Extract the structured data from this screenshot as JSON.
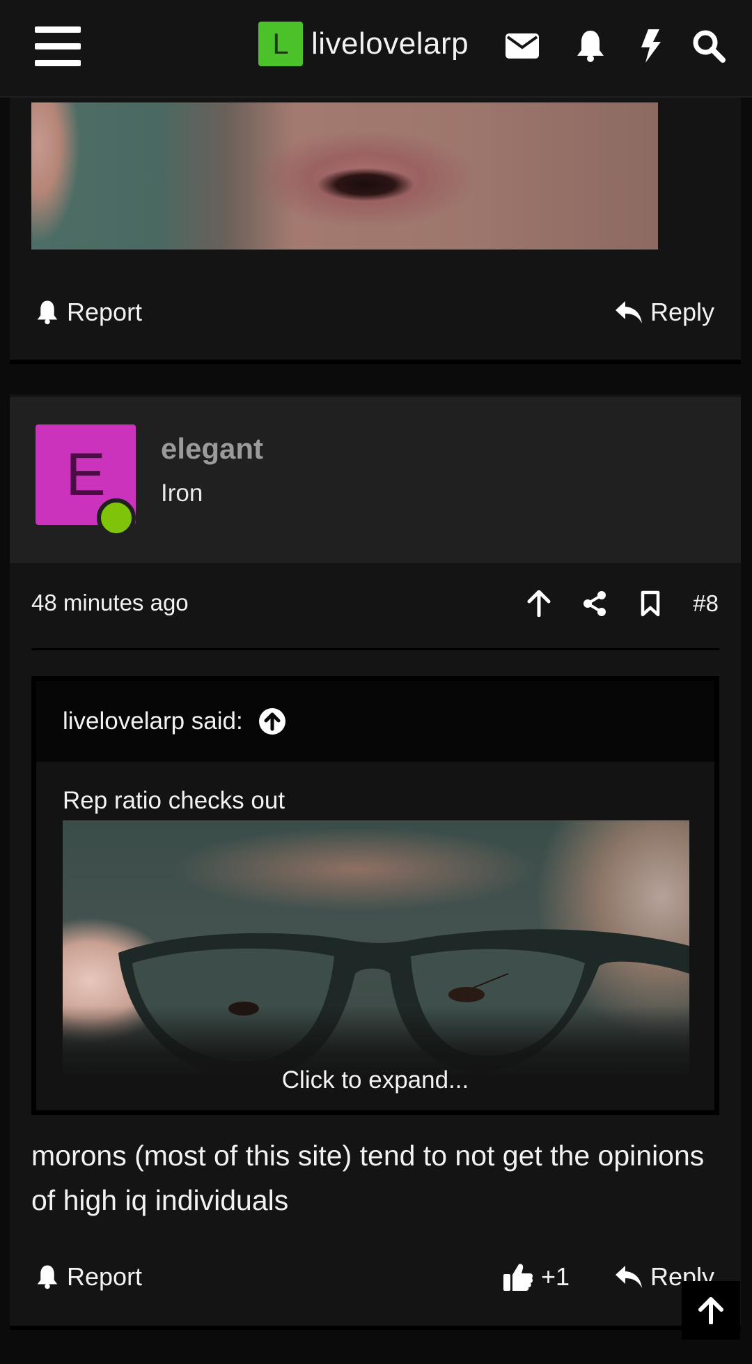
{
  "header": {
    "logo_letter": "L",
    "site_name": "livelovelarp",
    "icons": [
      "menu-icon",
      "envelope-icon",
      "bell-icon",
      "bolt-icon",
      "search-icon"
    ]
  },
  "previous_post": {
    "report_label": "Report",
    "reply_label": "Reply"
  },
  "post": {
    "avatar_letter": "E",
    "username": "elegant",
    "user_title": "Iron",
    "time": "48 minutes ago",
    "post_number": "#8",
    "quote": {
      "author_label": "livelovelarp said:",
      "text": "Rep ratio checks out",
      "expand_label": "Click to expand..."
    },
    "message": "morons (most of this site) tend to not get the opinions of high iq individuals",
    "report_label": "Report",
    "like_count": "+1",
    "reply_label": "Reply"
  },
  "colors": {
    "accent_logo": "#4cc22a",
    "avatar_bg": "#cc33bd",
    "online": "#7fc40b"
  }
}
